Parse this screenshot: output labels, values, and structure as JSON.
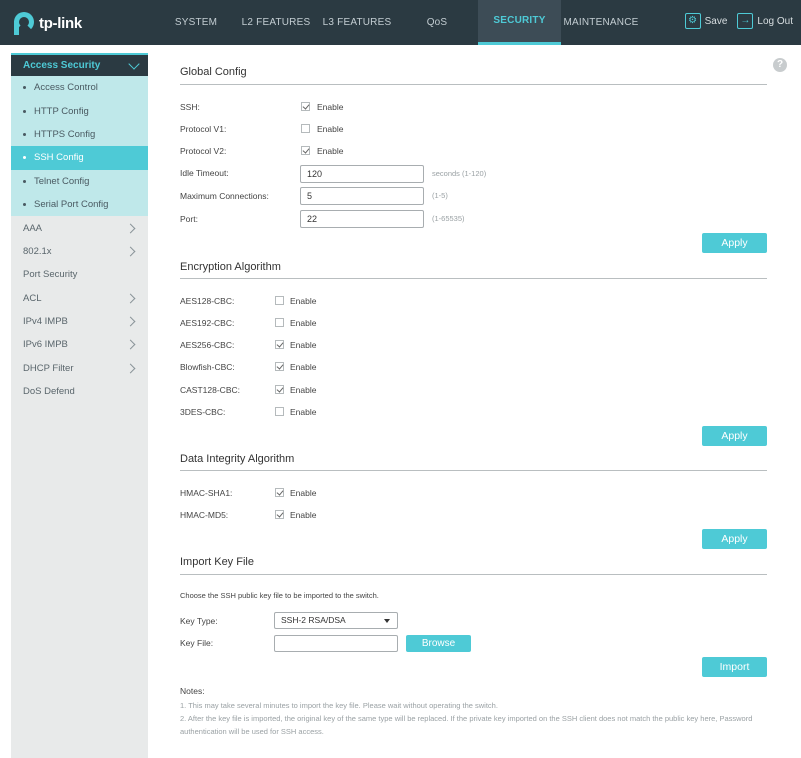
{
  "header": {
    "brand": "tp-link",
    "nav": [
      {
        "label": "SYSTEM",
        "active": false
      },
      {
        "label": "L2 FEATURES",
        "active": false
      },
      {
        "label": "L3 FEATURES",
        "active": false
      },
      {
        "label": "QoS",
        "active": false
      },
      {
        "label": "SECURITY",
        "active": true
      },
      {
        "label": "MAINTENANCE",
        "active": false
      }
    ],
    "save_label": "Save",
    "logout_label": "Log Out"
  },
  "sidebar": {
    "group_label": "Access Security",
    "sub_items": [
      {
        "label": "Access Control",
        "active": false
      },
      {
        "label": "HTTP Config",
        "active": false
      },
      {
        "label": "HTTPS Config",
        "active": false
      },
      {
        "label": "SSH Config",
        "active": true
      },
      {
        "label": "Telnet Config",
        "active": false
      },
      {
        "label": "Serial Port Config",
        "active": false
      }
    ],
    "items": [
      {
        "label": "AAA",
        "has_children": true
      },
      {
        "label": "802.1x",
        "has_children": true
      },
      {
        "label": "Port Security",
        "has_children": false
      },
      {
        "label": "ACL",
        "has_children": true
      },
      {
        "label": "IPv4 IMPB",
        "has_children": true
      },
      {
        "label": "IPv6 IMPB",
        "has_children": true
      },
      {
        "label": "DHCP Filter",
        "has_children": true
      },
      {
        "label": "DoS Defend",
        "has_children": false
      }
    ]
  },
  "help_symbol": "?",
  "global_config": {
    "title": "Global Config",
    "ssh_label": "SSH:",
    "ssh_enabled": true,
    "protocol_v1_label": "Protocol V1:",
    "protocol_v1_enabled": false,
    "protocol_v2_label": "Protocol V2:",
    "protocol_v2_enabled": true,
    "enable_label": "Enable",
    "idle_timeout_label": "Idle Timeout:",
    "idle_timeout_value": "120",
    "idle_timeout_hint": "seconds (1-120)",
    "max_conn_label": "Maximum Connections:",
    "max_conn_value": "5",
    "max_conn_hint": "(1-5)",
    "port_label": "Port:",
    "port_value": "22",
    "port_hint": "(1-65535)",
    "apply_label": "Apply"
  },
  "encryption": {
    "title": "Encryption Algorithm",
    "enable_label": "Enable",
    "apply_label": "Apply",
    "rows": [
      {
        "label": "AES128-CBC:",
        "enabled": false
      },
      {
        "label": "AES192-CBC:",
        "enabled": false
      },
      {
        "label": "AES256-CBC:",
        "enabled": true
      },
      {
        "label": "Blowfish-CBC:",
        "enabled": true
      },
      {
        "label": "CAST128-CBC:",
        "enabled": true
      },
      {
        "label": "3DES-CBC:",
        "enabled": false
      }
    ]
  },
  "integrity": {
    "title": "Data Integrity Algorithm",
    "enable_label": "Enable",
    "apply_label": "Apply",
    "rows": [
      {
        "label": "HMAC-SHA1:",
        "enabled": true
      },
      {
        "label": "HMAC-MD5:",
        "enabled": true
      }
    ]
  },
  "import": {
    "title": "Import Key File",
    "description": "Choose the SSH public key file to be imported to the switch.",
    "key_type_label": "Key Type:",
    "key_type_value": "SSH-2 RSA/DSA",
    "key_file_label": "Key File:",
    "browse_label": "Browse",
    "import_label": "Import"
  },
  "notes": {
    "title": "Notes:",
    "lines": [
      "1. This may take several minutes to import the key file. Please wait without operating the switch.",
      "2. After the key file is imported, the original key of the same type will be replaced. If the private key imported on the SSH client does not match the public key here, Password authentication will be used for SSH access."
    ]
  }
}
